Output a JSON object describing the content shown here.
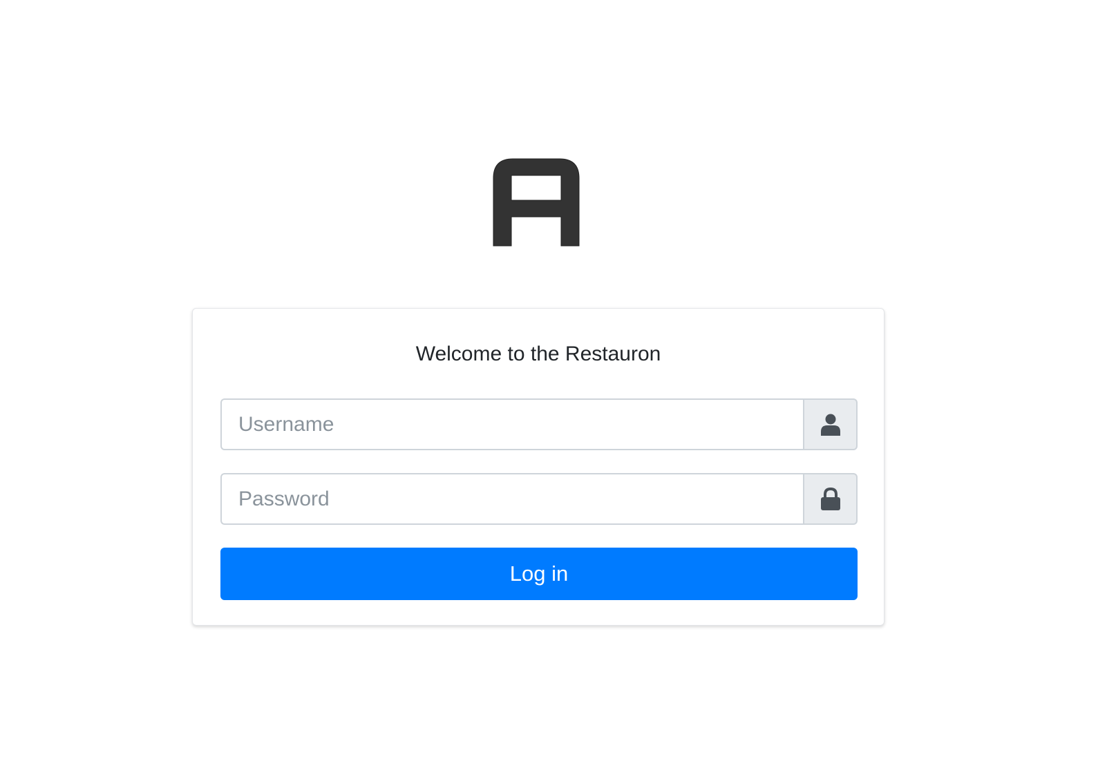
{
  "brand": {
    "logo_letter": "A"
  },
  "login": {
    "title": "Welcome to the Restauron",
    "username": {
      "value": "",
      "placeholder": "Username",
      "icon": "user-icon"
    },
    "password": {
      "value": "",
      "placeholder": "Password",
      "icon": "lock-icon"
    },
    "submit_label": "Log in"
  },
  "colors": {
    "primary": "#007bff",
    "logo": "#333333",
    "addon_bg": "#e9ecef",
    "icon": "#495057"
  }
}
